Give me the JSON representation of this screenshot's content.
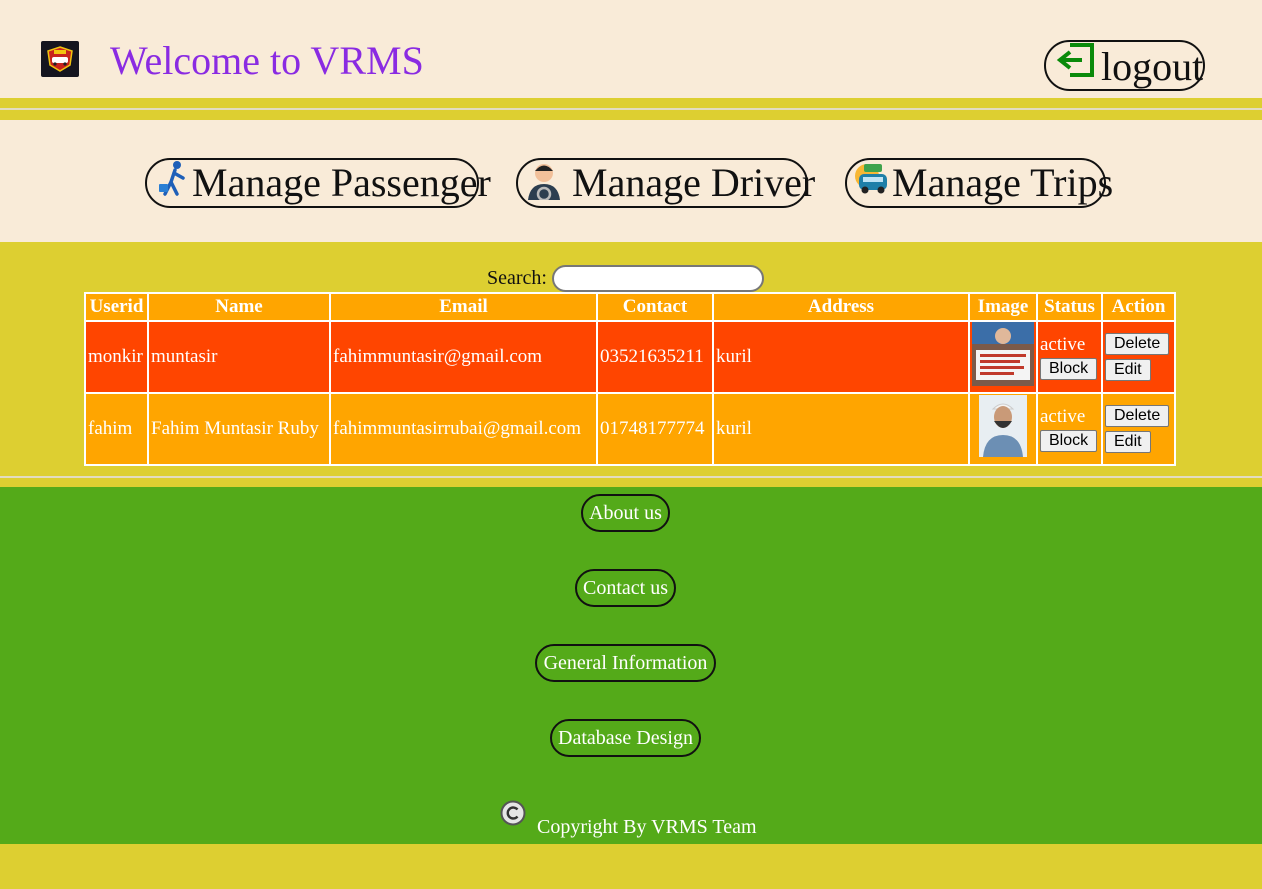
{
  "header": {
    "title": "Welcome to VRMS",
    "logo_text": "VRMS",
    "logout_label": "logout"
  },
  "nav": {
    "manage_passenger": "Manage Passenger",
    "manage_driver": "Manage Driver",
    "manage_trips": "Manage Trips"
  },
  "search": {
    "label": "Search:",
    "value": ""
  },
  "table": {
    "columns": [
      "Userid",
      "Name",
      "Email",
      "Contact",
      "Address",
      "Image",
      "Status",
      "Action"
    ],
    "rows": [
      {
        "userid": "monkir",
        "name": "muntasir",
        "email": "fahimmuntasir@gmail.com",
        "contact": "03521635211",
        "address": "kuril",
        "status": "active",
        "actions": {
          "delete": "Delete",
          "block": "Block",
          "edit": "Edit"
        },
        "row_color": "#ff4500"
      },
      {
        "userid": "fahim",
        "name": "Fahim Muntasir Ruby",
        "email": "fahimmuntasirrubai@gmail.com",
        "contact": "01748177774",
        "address": "kuril",
        "status": "active",
        "actions": {
          "delete": "Delete",
          "block": "Block",
          "edit": "Edit"
        },
        "row_color": "#ffa500"
      }
    ]
  },
  "footer": {
    "about": "About us",
    "contact": "Contact us",
    "general": "General Information",
    "database": "Database Design",
    "copyright": "Copyright By VRMS Team"
  },
  "colors": {
    "background": "#f9ebd8",
    "title": "#8a2be2",
    "band": "#ddcf31",
    "footer": "#54aa19",
    "header_cell": "#ffa500",
    "row_red": "#ff4500"
  }
}
